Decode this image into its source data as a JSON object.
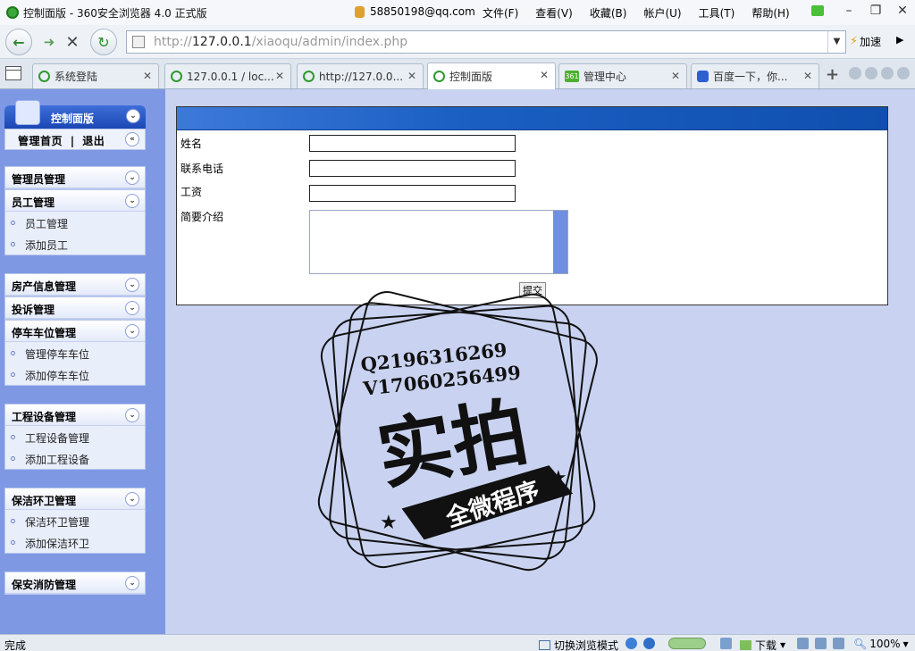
{
  "window": {
    "title": "控制面版 - 360安全浏览器 4.0 正式版",
    "user_email": "58850198@qq.com",
    "menus": [
      "文件(F)",
      "查看(V)",
      "收藏(B)",
      "帐户(U)",
      "工具(T)",
      "帮助(H)"
    ]
  },
  "navbar": {
    "url_prefix": "http://",
    "url_host": "127.0.0.1",
    "url_path": "/xiaoqu/admin/index.php",
    "accelerate_label": "加速"
  },
  "tabs": [
    {
      "label": "系统登陆",
      "active": false
    },
    {
      "label": "127.0.0.1 / loc...",
      "active": false
    },
    {
      "label": "http://127.0.0...",
      "active": false
    },
    {
      "label": "控制面版",
      "active": true
    },
    {
      "label": "管理中心",
      "active": false,
      "icon_text": "361"
    },
    {
      "label": "百度一下，你...",
      "active": false
    }
  ],
  "sidebar": {
    "header": "控制面版",
    "home_link": "管理首页",
    "separator": "|",
    "logout_link": "退出",
    "groups": [
      {
        "title": "管理员管理",
        "items": []
      },
      {
        "title": "员工管理",
        "items": [
          "员工管理",
          "添加员工"
        ]
      },
      {
        "title": "房产信息管理",
        "items": []
      },
      {
        "title": "投诉管理",
        "items": []
      },
      {
        "title": "停车车位管理",
        "items": [
          "管理停车车位",
          "添加停车车位"
        ]
      },
      {
        "title": "工程设备管理",
        "items": [
          "工程设备管理",
          "添加工程设备"
        ]
      },
      {
        "title": "保洁环卫管理",
        "items": [
          "保洁环卫管理",
          "添加保洁环卫"
        ]
      },
      {
        "title": "保安消防管理",
        "items": []
      }
    ]
  },
  "form": {
    "fields": [
      {
        "label": "姓名",
        "value": ""
      },
      {
        "label": "联系电话",
        "value": ""
      },
      {
        "label": "工资",
        "value": ""
      },
      {
        "label": "简要介绍",
        "value": ""
      }
    ],
    "submit_label": "提交"
  },
  "watermark": {
    "line1": "Q2196316269",
    "line2": "V17060256499",
    "main": "实拍",
    "ribbon": "全微程序"
  },
  "statusbar": {
    "status": "完成",
    "browse_mode": "切换浏览模式",
    "download": "下载",
    "zoom": "100%"
  }
}
